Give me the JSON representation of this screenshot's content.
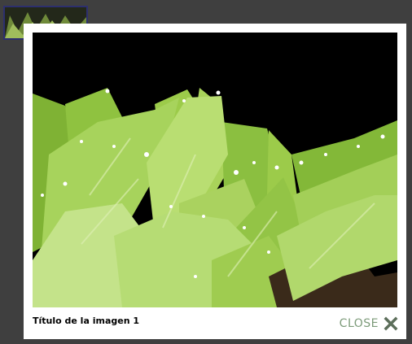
{
  "lightbox": {
    "caption": "Título de la imagen 1",
    "close_label": "CLOSE"
  },
  "colors": {
    "overlay": "#3f3f3f",
    "frame": "#ffffff",
    "close_text": "#7d9b7a",
    "thumb_border": "#2d2f6e"
  },
  "icons": {
    "close": "close-x-icon"
  }
}
